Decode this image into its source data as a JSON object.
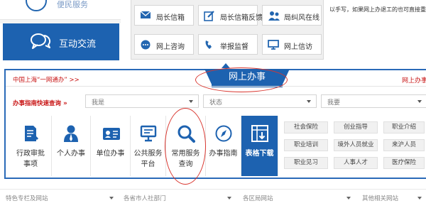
{
  "left_nav": {
    "top_item": "便民服务",
    "active_item": "互动交流"
  },
  "services": [
    {
      "label": "局长信箱",
      "icon": "mail-icon"
    },
    {
      "label": "局长信箱反馈",
      "icon": "edit-icon"
    },
    {
      "label": "局纠风在线",
      "icon": "people-icon"
    },
    {
      "label": "网上咨询",
      "icon": "chat-icon"
    },
    {
      "label": "举报监督",
      "icon": "phone-icon"
    },
    {
      "label": "网上信访",
      "icon": "monitor-icon"
    }
  ],
  "notice_text": "以手写，如果网上办退工的也可直接重",
  "main": {
    "breadcrumb": "中国上海“一网通办”",
    "breadcrumb_arrow": ">>",
    "tab_title": "网上办事",
    "right_label": "网上办事",
    "quick_query_label": "办事指南快速查询",
    "quick_query_arrow": "»",
    "selects": [
      {
        "value": "我是"
      },
      {
        "value": "状态"
      },
      {
        "value": "我要"
      }
    ],
    "categories": [
      {
        "label": "行政审批事项",
        "l1": "行政审批",
        "l2": "事项",
        "icon": "document-icon"
      },
      {
        "label": "个人办事",
        "l1": "个人办事",
        "l2": "",
        "icon": "person-icon"
      },
      {
        "label": "单位办事",
        "l1": "单位办事",
        "l2": "",
        "icon": "id-card-icon"
      },
      {
        "label": "公共服务平台",
        "l1": "公共服务",
        "l2": "平台",
        "icon": "screen-icon"
      },
      {
        "label": "常用服务查询",
        "l1": "常用服务",
        "l2": "查询",
        "icon": "search-icon"
      },
      {
        "label": "办事指南",
        "l1": "办事指南",
        "l2": "",
        "icon": "compass-icon"
      },
      {
        "label": "表格下载",
        "l1": "表格下载",
        "l2": "",
        "icon": "table-download-icon"
      }
    ],
    "tags": [
      [
        "社会保险",
        "创业指导",
        "职业介绍"
      ],
      [
        "职业培训",
        "境外人员就业",
        "来沪人员"
      ],
      [
        "职业见习",
        "人事人才",
        "医疗保险"
      ]
    ]
  },
  "bottom_selects": [
    {
      "value": "特色专栏及网站"
    },
    {
      "value": "各省市人社部门"
    },
    {
      "value": "各区局网站"
    },
    {
      "value": "其他相关网站"
    }
  ],
  "colors": {
    "primary_blue": "#1d62b0",
    "accent_red": "#c81414",
    "annotation_red": "#d9362f"
  }
}
